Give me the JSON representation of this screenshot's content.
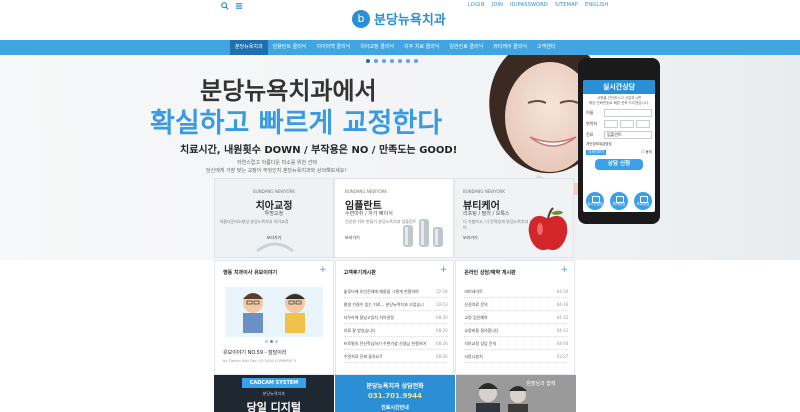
{
  "header": {
    "logo_mark": "b",
    "logo_text": "분당뉴욕치과",
    "search_icon": "search-icon",
    "menu_icon": "menu-icon",
    "links": [
      "LOGIN",
      "JOIN",
      "ID/PASSWORD",
      "SITEMAP",
      "ENGLISH"
    ]
  },
  "nav": {
    "items": [
      "분당뉴욕치과",
      "임플란트 클리닉",
      "치아미백 클리닉",
      "치아교정 클리닉",
      "치주 치료 클리닉",
      "일반진료 클리닉",
      "뷰티케어 클리닉",
      "고객센터"
    ],
    "active": 0
  },
  "hero": {
    "line1": "분당뉴욕치과에서",
    "line2": "확실하고 빠르게 교정한다",
    "line3": "치료시간, 내원횟수 DOWN / 부작용은 NO / 만족도는 GOOD!",
    "line4": "자연스럽고 아름다운 미소를 위한 선택",
    "line5": "당신에게 가장 맞는 교정이 무엇인지 분당뉴욕치과와 상의해보세요!"
  },
  "cards": [
    {
      "brand": "BUNDANG NEWYORK",
      "title": "치아교정",
      "sub": "투명교정",
      "desc": "아름다운미소완성 분당뉴욕치과 치아교정",
      "more": "보러가기"
    },
    {
      "brand": "BUNDANG NEWYORK",
      "title": "임플란트",
      "sub": "수면마취 / 자가 뼈이식",
      "desc": "건강한 치아 만들기 분당뉴욕치과 임플란트",
      "more": "보러가기"
    },
    {
      "brand": "BUNDANG NEWYORK",
      "title": "뷰티케어",
      "sub": "리프팅 / 필러 / 보톡스",
      "desc": "더 가볍하고, 더 탄력있게 분당뉴욕치과 뷰티케어",
      "more": "보러가기"
    }
  ],
  "consult": {
    "title": "실시간상담",
    "note1": "사용을 간단하시고 신분하시면",
    "note2": "해당 전화번호로 빠른 연락 드리겠습니다.",
    "name_label": "이름",
    "phone_label": "연락처",
    "type_label": "진료",
    "type_value": "임플란트",
    "privacy_label": "개인정보취급방침",
    "privacy_btn": "자세히보기",
    "agree_label": "동의",
    "submit": "상담 신청",
    "icons": [
      "실시간상담",
      "예약상담",
      "카톡상담"
    ]
  },
  "boards": {
    "story": {
      "title": "행동 치과이사 유모이야기",
      "caption": "유모이야기 NO.59 - 잠담이라",
      "meta": "by. Dental Wiki   Dec. 05 2016   COMMENT 0"
    },
    "reviews": {
      "title": "고객후기게시판",
      "rows": [
        {
          "t": "솔루터에 부인진대에 때들을 그렇게 친절하여",
          "d": "12-18"
        },
        {
          "t": "평생 가질수 있는 치료... 분당뉴욕치과 고맙습니",
          "d": "10-13"
        },
        {
          "t": "자꾸라에 잘났고있치 치아관정",
          "d": "08-20"
        },
        {
          "t": "치료 잘 받았습니다",
          "d": "08-20"
        },
        {
          "t": "프로필의 전신학님하기 주변가셨 선생님 친절하여",
          "d": "08-26"
        },
        {
          "t": "수면치료 진짜 좋아요!!",
          "d": "08-26"
        }
      ]
    },
    "online": {
      "title": "온라인 상담/예약 게시판",
      "rows": [
        {
          "t": "라미네이트",
          "d": "04-20"
        },
        {
          "t": "신경치료 문의",
          "d": "04-16"
        },
        {
          "t": "교정 임진예약",
          "d": "04-15"
        },
        {
          "t": "교정비용 질의합니다",
          "d": "04-11"
        },
        {
          "t": "치아교정 상담 문의",
          "d": "04-04"
        },
        {
          "t": "사랑니발치",
          "d": "03-27"
        }
      ]
    }
  },
  "bottom": {
    "cadcam": "CADCAM SYSTEM",
    "cadcam_sub": "분당뉴욕치과",
    "cadcam_big": "당일 디지털",
    "phone_title": "분당뉴욕치과 상담전화",
    "phone_number": "031.701.9944",
    "phone_hours": "진료시간안내",
    "sign": "원장님과 함께"
  },
  "colors": {
    "accent": "#2a8fd4",
    "nav": "#40a5e0",
    "nav_active": "#1f6fb2"
  }
}
